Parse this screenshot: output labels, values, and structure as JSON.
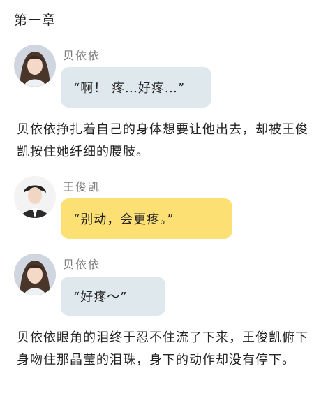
{
  "header": {
    "title": "第一章"
  },
  "messages": [
    {
      "speaker": "贝依依",
      "text": "“啊！ 疼…好疼…”",
      "bubble_color": "#dfe8ec",
      "avatar": "girl-avatar"
    },
    {
      "speaker": "王俊凯",
      "text": "“别动，会更疼。”",
      "bubble_color": "#fde074",
      "avatar": "boy-avatar"
    },
    {
      "speaker": "贝依依",
      "text": "“好疼～”",
      "bubble_color": "#dfe8ec",
      "avatar": "girl-avatar"
    }
  ],
  "narration": [
    "贝依依挣扎着自己的身体想要让他出去，却被王俊凯按住她纤细的腰肢。",
    "贝依依眼角的泪终于忍不住流了下来，王俊凯俯下身吻住那晶莹的泪珠，身下的动作却没有停下。"
  ]
}
